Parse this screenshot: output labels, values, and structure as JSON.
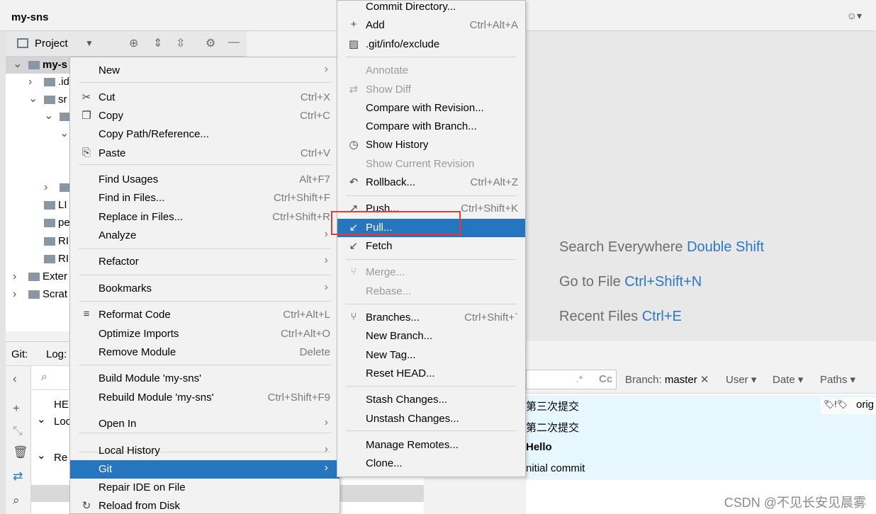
{
  "window": {
    "project_title": "my-sns",
    "user_menu": "☺▾"
  },
  "project_bar": {
    "title": "Project",
    "tool_icons": [
      "locate-icon",
      "expand-all-icon",
      "collapse-all-icon",
      "settings-icon",
      "minimize-icon"
    ]
  },
  "tree": {
    "items": [
      {
        "label": "my-s",
        "depth": 0,
        "expanded": true,
        "selected": true
      },
      {
        "label": ".id",
        "depth": 1,
        "expanded": false
      },
      {
        "label": "sr",
        "depth": 1,
        "expanded": true
      },
      {
        "label": "",
        "depth": 2,
        "expanded": true
      },
      {
        "label": "",
        "depth": 3,
        "expanded": true
      },
      {
        "label": "",
        "depth": 2,
        "expanded": false
      },
      {
        "label": "LI",
        "depth": 1
      },
      {
        "label": "pe",
        "depth": 1
      },
      {
        "label": "RI",
        "depth": 1
      },
      {
        "label": "RI",
        "depth": 1
      },
      {
        "label": "Exter",
        "depth": 0,
        "expanded": false
      },
      {
        "label": "Scrat",
        "depth": 0,
        "expanded": false
      }
    ]
  },
  "git_panel": {
    "tab_git": "Git:",
    "tab_log": "Log:",
    "branches": [
      {
        "label": "HE"
      },
      {
        "label": "Loc"
      },
      {
        "label": "Re"
      }
    ]
  },
  "editor_hints": [
    {
      "text": "Search Everywhere",
      "key": "Double Shift"
    },
    {
      "text": "Go to File",
      "key": "Ctrl+Shift+N"
    },
    {
      "text": "Recent Files",
      "key": "Ctrl+E"
    }
  ],
  "log": {
    "regex_icon": ".*",
    "case_icon": "Cc",
    "branch_label": "Branch:",
    "branch_value": "master",
    "filter_user": "User",
    "filter_date": "Date",
    "filter_paths": "Paths",
    "commits": [
      {
        "message": "第三次提交",
        "bold": false,
        "tag": "orig"
      },
      {
        "message": "第二次提交",
        "bold": false
      },
      {
        "message": "Hello",
        "bold": true
      },
      {
        "message": "nitial commit",
        "bold": false
      }
    ]
  },
  "context_menu": {
    "items": [
      {
        "type": "item",
        "label": "New",
        "shortcut": "",
        "submenu": true,
        "icon": ""
      },
      {
        "type": "sep"
      },
      {
        "type": "item",
        "label": "Cut",
        "shortcut": "Ctrl+X",
        "icon": "✂"
      },
      {
        "type": "item",
        "label": "Copy",
        "shortcut": "Ctrl+C",
        "icon": "❐"
      },
      {
        "type": "item",
        "label": "Copy Path/Reference...",
        "shortcut": ""
      },
      {
        "type": "item",
        "label": "Paste",
        "shortcut": "Ctrl+V",
        "icon": "⎘"
      },
      {
        "type": "sep"
      },
      {
        "type": "item",
        "label": "Find Usages",
        "shortcut": "Alt+F7"
      },
      {
        "type": "item",
        "label": "Find in Files...",
        "shortcut": "Ctrl+Shift+F"
      },
      {
        "type": "item",
        "label": "Replace in Files...",
        "shortcut": "Ctrl+Shift+R"
      },
      {
        "type": "item",
        "label": "Analyze",
        "submenu": true
      },
      {
        "type": "sep"
      },
      {
        "type": "item",
        "label": "Refactor",
        "submenu": true
      },
      {
        "type": "sep"
      },
      {
        "type": "item",
        "label": "Bookmarks",
        "submenu": true
      },
      {
        "type": "sep"
      },
      {
        "type": "item",
        "label": "Reformat Code",
        "shortcut": "Ctrl+Alt+L",
        "icon": "≡"
      },
      {
        "type": "item",
        "label": "Optimize Imports",
        "shortcut": "Ctrl+Alt+O"
      },
      {
        "type": "item",
        "label": "Remove Module",
        "shortcut": "Delete"
      },
      {
        "type": "sep"
      },
      {
        "type": "item",
        "label": "Build Module 'my-sns'",
        "shortcut": ""
      },
      {
        "type": "item",
        "label": "Rebuild Module 'my-sns'",
        "shortcut": "Ctrl+Shift+F9"
      },
      {
        "type": "sep"
      },
      {
        "type": "item",
        "label": "Open In",
        "submenu": true
      },
      {
        "type": "sep"
      },
      {
        "type": "item",
        "label": "Local History",
        "submenu": true
      },
      {
        "type": "item",
        "label": "Git",
        "submenu": true,
        "highlighted": true
      },
      {
        "type": "item",
        "label": "Repair IDE on File"
      },
      {
        "type": "item",
        "label": "Reload from Disk",
        "icon": "↻"
      }
    ]
  },
  "git_menu": {
    "items": [
      {
        "type": "item",
        "label": "Commit Directory..."
      },
      {
        "type": "item",
        "label": "Add",
        "shortcut": "Ctrl+Alt+A",
        "icon": "+"
      },
      {
        "type": "item",
        "label": ".git/info/exclude",
        "icon": "▨"
      },
      {
        "type": "sep"
      },
      {
        "type": "item",
        "label": "Annotate",
        "disabled": true
      },
      {
        "type": "item",
        "label": "Show Diff",
        "disabled": true,
        "icon": "⇄"
      },
      {
        "type": "item",
        "label": "Compare with Revision..."
      },
      {
        "type": "item",
        "label": "Compare with Branch..."
      },
      {
        "type": "item",
        "label": "Show History",
        "icon": "◷"
      },
      {
        "type": "item",
        "label": "Show Current Revision",
        "disabled": true
      },
      {
        "type": "item",
        "label": "Rollback...",
        "shortcut": "Ctrl+Alt+Z",
        "icon": "↶"
      },
      {
        "type": "sep"
      },
      {
        "type": "item",
        "label": "Push...",
        "shortcut": "Ctrl+Shift+K",
        "icon": "↗"
      },
      {
        "type": "item",
        "label": "Pull...",
        "highlighted": true,
        "icon": "↙"
      },
      {
        "type": "item",
        "label": "Fetch",
        "icon": "↙"
      },
      {
        "type": "sep"
      },
      {
        "type": "item",
        "label": "Merge...",
        "disabled": true,
        "icon": "⑂"
      },
      {
        "type": "item",
        "label": "Rebase...",
        "disabled": true
      },
      {
        "type": "sep"
      },
      {
        "type": "item",
        "label": "Branches...",
        "shortcut": "Ctrl+Shift+`",
        "icon": "⑂"
      },
      {
        "type": "item",
        "label": "New Branch..."
      },
      {
        "type": "item",
        "label": "New Tag..."
      },
      {
        "type": "item",
        "label": "Reset HEAD..."
      },
      {
        "type": "sep"
      },
      {
        "type": "item",
        "label": "Stash Changes..."
      },
      {
        "type": "item",
        "label": "Unstash Changes..."
      },
      {
        "type": "sep"
      },
      {
        "type": "item",
        "label": "Manage Remotes..."
      },
      {
        "type": "item",
        "label": "Clone..."
      }
    ]
  },
  "watermark": "CSDN @不见长安见晨雾",
  "colors": {
    "highlight": "#2675bf",
    "link_key": "#2a78c6",
    "commit_row": "#e6f7fd",
    "callout_border": "#e53935"
  }
}
